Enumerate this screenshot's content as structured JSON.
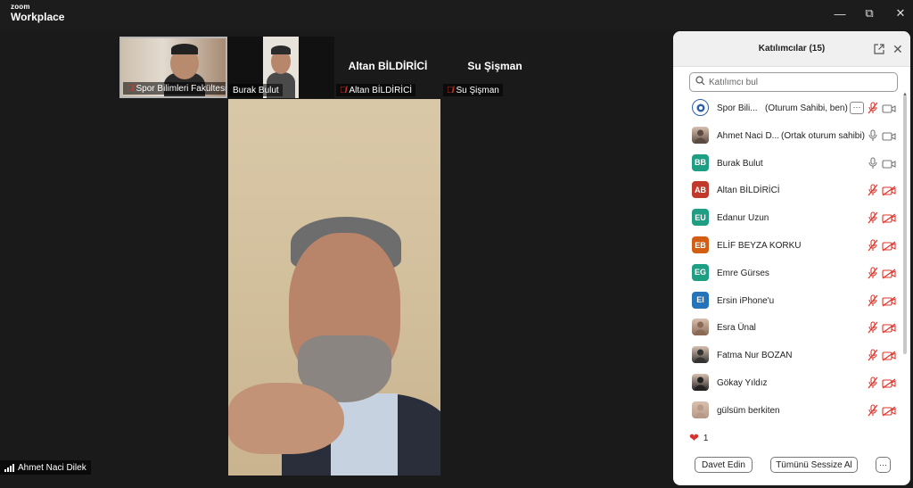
{
  "app": {
    "logo_top": "zoom",
    "logo_bottom": "Workplace"
  },
  "window_controls": {
    "minimize": "—",
    "maximize": "⧉",
    "close": "✕"
  },
  "thumbnails": [
    {
      "name": "Spor Bilimleri Fakültesi",
      "muted": true
    },
    {
      "name": "Burak Bulut",
      "muted": false
    },
    {
      "name": "Altan BİLDİRİCİ",
      "muted": true,
      "big_name": "Altan BİLDİRİCİ"
    },
    {
      "name": "Su Şişman",
      "muted": true,
      "big_name": "Su Şişman"
    }
  ],
  "speaker": {
    "name": "Ahmet Naci Dilek"
  },
  "panel": {
    "title": "Katılımcılar (15)",
    "search_placeholder": "Katılımcı bul",
    "participants": [
      {
        "name": "Spor Bili...",
        "role": "(Oturum Sahibi, ben)",
        "avatar_type": "logo",
        "color": "#ffffff",
        "mic": "off",
        "cam": "on",
        "more": true
      },
      {
        "name": "Ahmet Naci D...",
        "role": "(Ortak oturum sahibi)",
        "avatar_type": "photo",
        "color": "#5a4a40",
        "mic": "on",
        "cam": "on"
      },
      {
        "name": "Burak Bulut",
        "initials": "BB",
        "color": "#1e9e83",
        "mic": "on",
        "cam": "on"
      },
      {
        "name": "Altan BİLDİRİCİ",
        "initials": "AB",
        "color": "#c0392b",
        "mic": "off",
        "cam": "off"
      },
      {
        "name": "Edanur Uzun",
        "initials": "EU",
        "color": "#1e9e83",
        "mic": "off",
        "cam": "off"
      },
      {
        "name": "ELİF BEYZA KORKU",
        "initials": "EB",
        "color": "#d35d12",
        "mic": "off",
        "cam": "off"
      },
      {
        "name": "Emre Gürses",
        "initials": "EG",
        "color": "#1e9e83",
        "mic": "off",
        "cam": "off"
      },
      {
        "name": "Ersin iPhone'u",
        "initials": "EI",
        "color": "#2573b8",
        "mic": "off",
        "cam": "off"
      },
      {
        "name": "Esra Ünal",
        "avatar_type": "photo",
        "color": "#8a6a55",
        "mic": "off",
        "cam": "off"
      },
      {
        "name": "Fatma Nur BOZAN",
        "avatar_type": "photo",
        "color": "#333333",
        "mic": "off",
        "cam": "off"
      },
      {
        "name": "Gökay Yıldız",
        "avatar_type": "photo",
        "color": "#222222",
        "mic": "off",
        "cam": "off"
      },
      {
        "name": "gülsüm berkiten",
        "avatar_type": "photo",
        "color": "#b89a88",
        "mic": "off",
        "cam": "off"
      }
    ],
    "reaction_count": "1",
    "invite_label": "Davet Edin",
    "mute_all_label": "Tümünü Sessize Al",
    "more_label": "···"
  },
  "colors": {
    "muted_red": "#e0352b",
    "panel_bg": "#ffffff",
    "app_bg": "#1a1a1a"
  }
}
